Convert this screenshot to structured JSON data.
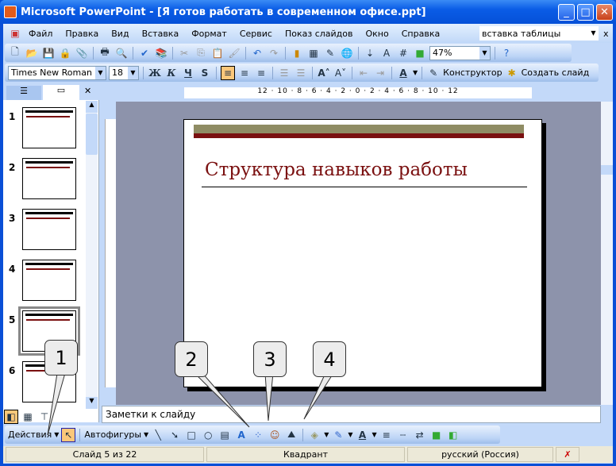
{
  "window": {
    "title": "Microsoft PowerPoint - [Я готов работать в современном офисе.ppt]"
  },
  "menu": {
    "items": [
      "Файл",
      "Правка",
      "Вид",
      "Вставка",
      "Формат",
      "Сервис",
      "Показ слайдов",
      "Окно",
      "Справка"
    ],
    "help_search": "вставка таблицы",
    "close": "x"
  },
  "toolbar": {
    "zoom": "47%"
  },
  "formatting": {
    "font": "Times New Roman",
    "size": "18",
    "bold": "Ж",
    "italic": "К",
    "underline": "Ч",
    "shadow": "S",
    "designer": "Конструктор",
    "new_slide": "Создать слайд"
  },
  "ruler": {
    "h_labels": "12 · 10 · 8 · 6 · 4 · 2 · 0 · 2 · 4 · 6 · 8 · 10 · 12"
  },
  "thumbnails": [
    {
      "num": "1"
    },
    {
      "num": "2"
    },
    {
      "num": "3"
    },
    {
      "num": "4"
    },
    {
      "num": "5",
      "selected": true
    },
    {
      "num": "6"
    }
  ],
  "slide": {
    "title": "Структура навыков работы",
    "accent": "#7a1010",
    "bar_color": "#8f8c64"
  },
  "notes": {
    "placeholder": "Заметки к слайду"
  },
  "drawing": {
    "actions": "Действия",
    "autoshapes": "Автофигуры"
  },
  "status": {
    "slide": "Слайд 5 из 22",
    "design": "Квадрант",
    "language": "русский (Россия)"
  },
  "callouts": [
    "1",
    "2",
    "3",
    "4"
  ]
}
